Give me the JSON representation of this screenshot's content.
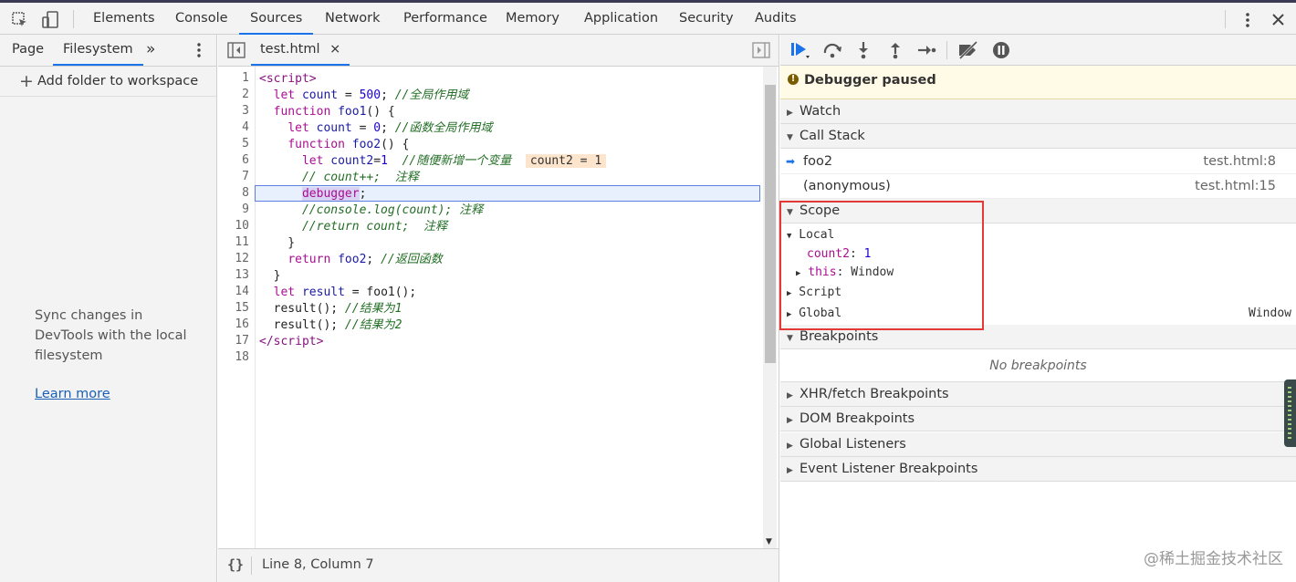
{
  "toolbar": {
    "tabs": [
      "Elements",
      "Console",
      "Sources",
      "Network",
      "Performance",
      "Memory",
      "Application",
      "Security",
      "Audits"
    ],
    "active_tab": "Sources"
  },
  "navigator": {
    "tabs": [
      "Page",
      "Filesystem"
    ],
    "more": "»",
    "add_folder": "Add folder to workspace",
    "sync_text": "Sync changes in DevTools with the local filesystem",
    "learn_more": "Learn more"
  },
  "editor": {
    "file_tab": "test.html",
    "close": "×",
    "inline_value": "count2 = 1",
    "status_braces": "{}",
    "status": "Line 8, Column 7",
    "line_numbers": [
      "1",
      "2",
      "3",
      "4",
      "5",
      "6",
      "7",
      "8",
      "9",
      "10",
      "11",
      "12",
      "13",
      "14",
      "15",
      "16",
      "17",
      "18"
    ]
  },
  "debugger": {
    "paused_banner": "Debugger paused",
    "sections": {
      "watch": "Watch",
      "call_stack": "Call Stack",
      "scope": "Scope",
      "breakpoints": "Breakpoints",
      "no_breakpoints": "No breakpoints",
      "xhr": "XHR/fetch Breakpoints",
      "dom": "DOM Breakpoints",
      "global_listeners": "Global Listeners",
      "event_listeners": "Event Listener Breakpoints"
    },
    "frames": [
      {
        "name": "foo2",
        "location": "test.html:8"
      },
      {
        "name": "(anonymous)",
        "location": "test.html:15"
      }
    ],
    "scope": {
      "local": "Local",
      "var_name": "count2",
      "var_value": "1",
      "this_name": "this",
      "this_value": "Window",
      "script": "Script",
      "global": "Global",
      "global_value": "Window"
    }
  },
  "watermark": "@稀土掘金技术社区",
  "colors": {
    "accent": "#1a73e8",
    "highlight_box": "#e53935",
    "banner": "#fffbe6"
  }
}
